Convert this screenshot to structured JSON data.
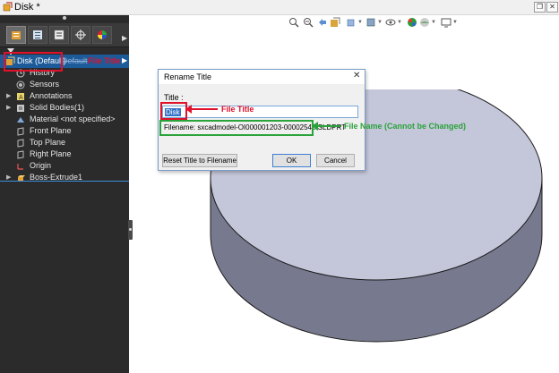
{
  "window": {
    "title": "Disk *"
  },
  "feature_tree": {
    "root": {
      "label": "Disk (Default)",
      "hidden_label": "Default"
    },
    "items": [
      {
        "label": "History",
        "expandable": false
      },
      {
        "label": "Sensors",
        "expandable": false
      },
      {
        "label": "Annotations",
        "expandable": true
      },
      {
        "label": "Solid Bodies(1)",
        "expandable": true
      },
      {
        "label": "Material <not specified>",
        "expandable": false
      },
      {
        "label": "Front Plane",
        "expandable": false
      },
      {
        "label": "Top Plane",
        "expandable": false
      },
      {
        "label": "Right Plane",
        "expandable": false
      },
      {
        "label": "Origin",
        "expandable": false
      },
      {
        "label": "Boss-Extrude1",
        "expandable": true
      }
    ]
  },
  "annotations": {
    "tree_file_title": "File Title",
    "dialog_file_title": "File Title",
    "dialog_file_name": "File Name (Cannot be Changed)"
  },
  "dialog": {
    "title": "Rename Title",
    "close": "✕",
    "title_label": "Title :",
    "title_value": "Disk",
    "filename": "Filename: sxcadmodel-OI000001203-00002548.SLDPRT",
    "reset_button": "Reset Title to Filename",
    "ok_button": "OK",
    "cancel_button": "Cancel"
  },
  "colors": {
    "accent_red": "#e0112b",
    "accent_green": "#2aa33a",
    "selection_blue": "#1c5a99",
    "panel_bg": "#2b2b2b",
    "disk_top": "#c6c8dc",
    "disk_side": "#7c7f93"
  }
}
